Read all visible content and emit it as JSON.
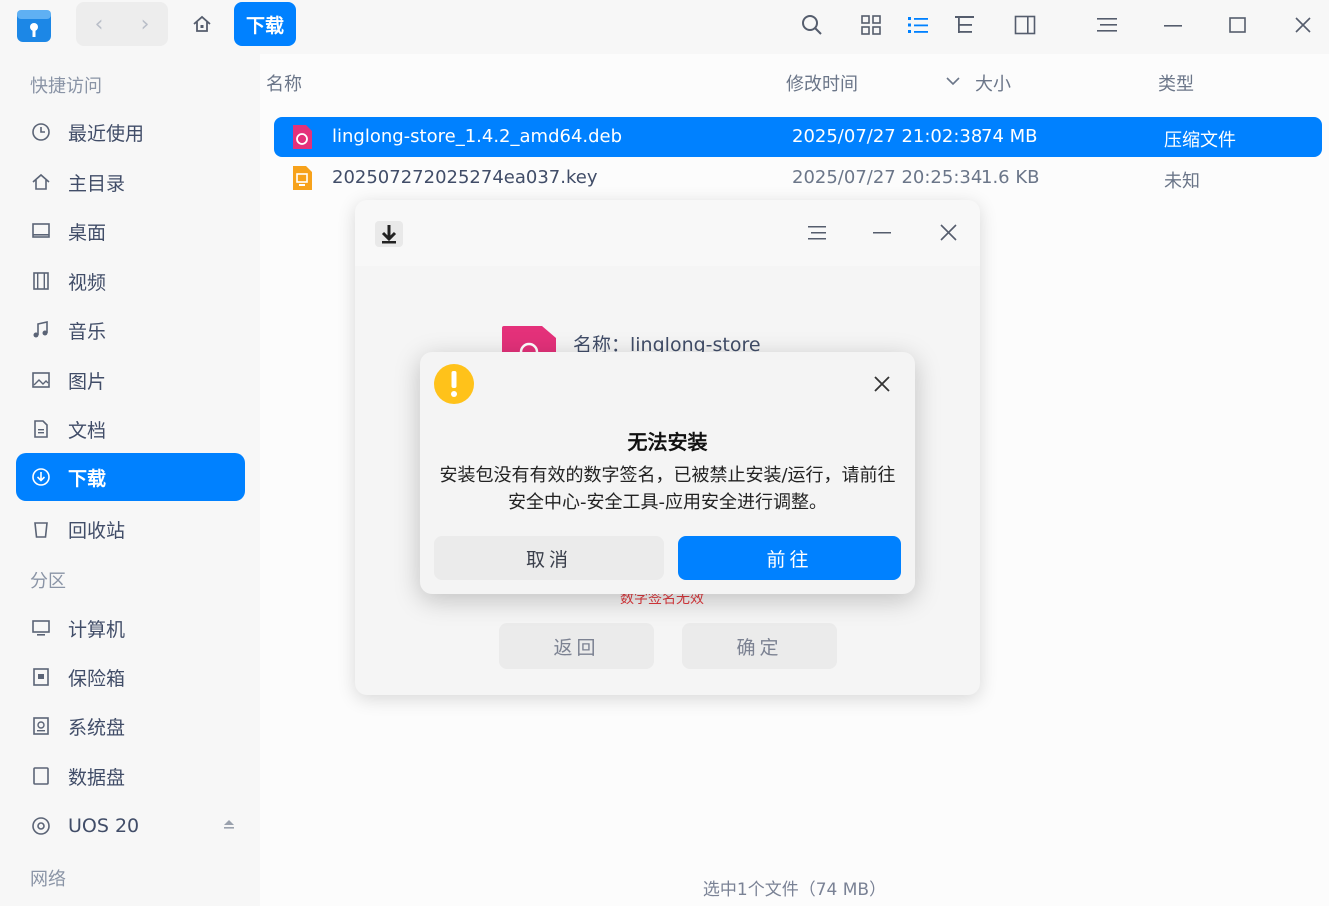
{
  "toolbar": {
    "breadcrumb": "下载",
    "back_glyph": "‹",
    "forward_glyph": "›",
    "icons": [
      "search-icon",
      "icon-view-icon",
      "list-view-icon",
      "tree-view-icon",
      "detail-panel-icon",
      "menu-icon",
      "minimize-icon",
      "maximize-icon",
      "close-icon"
    ]
  },
  "sidebar": {
    "quick_access_label": "快捷访问",
    "items": [
      {
        "label": "最近使用",
        "icon": "clock-icon"
      },
      {
        "label": "主目录",
        "icon": "home-icon"
      },
      {
        "label": "桌面",
        "icon": "desktop-icon"
      },
      {
        "label": "视频",
        "icon": "video-icon"
      },
      {
        "label": "音乐",
        "icon": "music-icon"
      },
      {
        "label": "图片",
        "icon": "picture-icon"
      },
      {
        "label": "文档",
        "icon": "document-icon"
      },
      {
        "label": "下载",
        "icon": "download-icon"
      },
      {
        "label": "回收站",
        "icon": "trash-icon"
      }
    ],
    "partition_label": "分区",
    "partitions": [
      {
        "label": "计算机",
        "icon": "computer-icon"
      },
      {
        "label": "保险箱",
        "icon": "vault-icon"
      },
      {
        "label": "系统盘",
        "icon": "disk-icon"
      },
      {
        "label": "数据盘",
        "icon": "disk-icon"
      },
      {
        "label": "UOS 20",
        "icon": "disc-icon"
      }
    ],
    "network_label": "网络"
  },
  "columns": {
    "name": "名称",
    "modified": "修改时间",
    "size": "大小",
    "type": "类型"
  },
  "files": [
    {
      "name": "linglong-store_1.4.2_amd64.deb",
      "modified": "2025/07/27 21:02:38",
      "size": "74 MB",
      "type": "压缩文件"
    },
    {
      "name": "202507272025274ea037.key",
      "modified": "2025/07/27 20:25:34",
      "size": "1.6 KB",
      "type": "未知"
    }
  ],
  "status_bar": "选中1个文件（74 MB）",
  "installer": {
    "name_label": "名称：linglong-store",
    "error_hint": "数字签名无效",
    "back_button": "返回",
    "confirm_button": "确定"
  },
  "alert": {
    "title": "无法安装",
    "message_line1": "安装包没有有效的数字签名，已被禁止安装/运行，请前往",
    "message_line2": "安全中心-安全工具-应用安全进行调整。",
    "cancel_button": "取消",
    "go_button": "前往"
  },
  "colors": {
    "accent": "#0081ff",
    "warning": "#ffc21a",
    "deb_icon": "#e4317a"
  }
}
